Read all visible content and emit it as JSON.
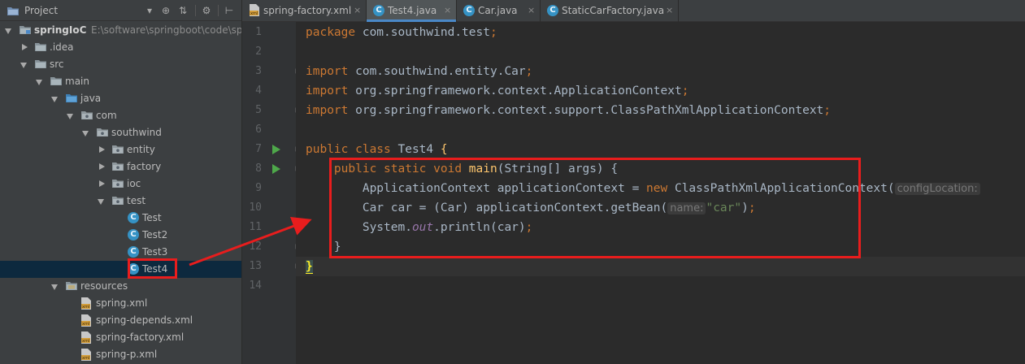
{
  "project_panel": {
    "title": "Project",
    "buttons": [
      "▾",
      "⊕",
      "⇅",
      "⚙",
      "⊢"
    ],
    "tree": [
      {
        "label": "springIoC",
        "path": "E:\\software\\springboot\\code\\sp",
        "indent": 0,
        "expanded": true,
        "icon": "module-folder-icon",
        "bold": true
      },
      {
        "label": ".idea",
        "indent": 1,
        "expanded": false,
        "icon": "folder-icon"
      },
      {
        "label": "src",
        "indent": 1,
        "expanded": true,
        "icon": "folder-icon"
      },
      {
        "label": "main",
        "indent": 2,
        "expanded": true,
        "icon": "folder-icon"
      },
      {
        "label": "java",
        "indent": 3,
        "expanded": true,
        "icon": "source-folder-icon"
      },
      {
        "label": "com",
        "indent": 4,
        "expanded": true,
        "icon": "package-icon"
      },
      {
        "label": "southwind",
        "indent": 5,
        "expanded": true,
        "icon": "package-icon"
      },
      {
        "label": "entity",
        "indent": 6,
        "expanded": false,
        "icon": "package-icon"
      },
      {
        "label": "factory",
        "indent": 6,
        "expanded": false,
        "icon": "package-icon"
      },
      {
        "label": "ioc",
        "indent": 6,
        "expanded": false,
        "icon": "package-icon"
      },
      {
        "label": "test",
        "indent": 6,
        "expanded": true,
        "icon": "package-icon"
      },
      {
        "label": "Test",
        "indent": 7,
        "icon": "java-class-icon"
      },
      {
        "label": "Test2",
        "indent": 7,
        "icon": "java-class-icon"
      },
      {
        "label": "Test3",
        "indent": 7,
        "icon": "java-class-icon"
      },
      {
        "label": "Test4",
        "indent": 7,
        "icon": "java-class-icon",
        "selected": true
      },
      {
        "label": "resources",
        "indent": 3,
        "expanded": true,
        "icon": "resources-folder-icon"
      },
      {
        "label": "spring.xml",
        "indent": 4,
        "icon": "xml-file-icon"
      },
      {
        "label": "spring-depends.xml",
        "indent": 4,
        "icon": "xml-file-icon"
      },
      {
        "label": "spring-factory.xml",
        "indent": 4,
        "icon": "xml-file-icon"
      },
      {
        "label": "spring-p.xml",
        "indent": 4,
        "icon": "xml-file-icon"
      }
    ]
  },
  "tabs": [
    {
      "label": "spring-factory.xml",
      "icon": "xml-file-icon",
      "active": false
    },
    {
      "label": "Test4.java",
      "icon": "java-class-icon",
      "active": true
    },
    {
      "label": "Car.java",
      "icon": "java-class-icon",
      "active": false
    },
    {
      "label": "StaticCarFactory.java",
      "icon": "java-class-icon",
      "active": false
    }
  ],
  "tab_close_glyph": "×",
  "class_icon_glyph": "C",
  "editor": {
    "line_numbers": [
      "1",
      "2",
      "3",
      "4",
      "5",
      "6",
      "7",
      "8",
      "9",
      "10",
      "11",
      "12",
      "13",
      "14"
    ],
    "run_lines": [
      7,
      8
    ],
    "caret_line": 13,
    "lines": [
      [
        {
          "t": "package",
          "c": "kw"
        },
        {
          "t": " com.southwind.test"
        },
        {
          "t": ";",
          "c": "kw"
        }
      ],
      [],
      [
        {
          "t": "import",
          "c": "kw"
        },
        {
          "t": " com.southwind.entity.Car"
        },
        {
          "t": ";",
          "c": "kw"
        }
      ],
      [
        {
          "t": "import",
          "c": "kw"
        },
        {
          "t": " org.springframework.context.ApplicationContext"
        },
        {
          "t": ";",
          "c": "kw"
        }
      ],
      [
        {
          "t": "import",
          "c": "kw"
        },
        {
          "t": " org.springframework.context.support.ClassPathXmlApplicationContext"
        },
        {
          "t": ";",
          "c": "kw"
        }
      ],
      [],
      [
        {
          "t": "public class",
          "c": "kw"
        },
        {
          "t": " Test4 "
        },
        {
          "t": "{",
          "c": "fn"
        }
      ],
      [
        {
          "t": "    "
        },
        {
          "t": "public static void",
          "c": "kw"
        },
        {
          "t": " "
        },
        {
          "t": "main",
          "c": "fn"
        },
        {
          "t": "(String[] args) {"
        }
      ],
      [
        {
          "t": "        ApplicationContext applicationContext = "
        },
        {
          "t": "new",
          "c": "kw"
        },
        {
          "t": " ClassPathXmlApplicationContext("
        },
        {
          "t": "configLocation:",
          "c": "hint"
        }
      ],
      [
        {
          "t": "        Car car = (Car) applicationContext.getBean("
        },
        {
          "t": "name:",
          "c": "hint"
        },
        {
          "t": "\"car\"",
          "c": "str"
        },
        {
          "t": ")"
        },
        {
          "t": ";",
          "c": "kw"
        }
      ],
      [
        {
          "t": "        System."
        },
        {
          "t": "out",
          "c": "it"
        },
        {
          "t": ".println(car)"
        },
        {
          "t": ";",
          "c": "kw"
        }
      ],
      [
        {
          "t": "    }"
        }
      ],
      [
        {
          "t": "}",
          "c": "brace-hl"
        }
      ],
      []
    ]
  },
  "colors": {
    "annotation_red": "#e81d1d",
    "keyword": "#cc7832",
    "method": "#ffc66d",
    "string": "#6a8759",
    "class_icon_blue": "#3592c4"
  }
}
